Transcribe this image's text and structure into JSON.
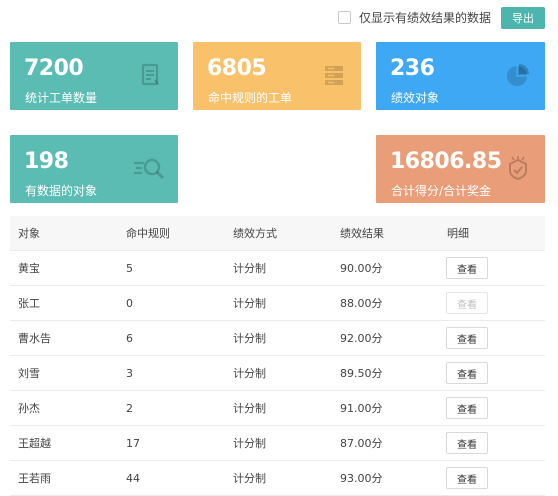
{
  "toolbar": {
    "filter_label": "仅显示有绩效结果的数据",
    "export_label": "导出"
  },
  "cards": [
    {
      "value": "7200",
      "label": "统计工单数量",
      "icon": "document-icon",
      "color": "#5bbcb4"
    },
    {
      "value": "6805",
      "label": "命中规则的工单",
      "icon": "layers-icon",
      "color": "#f9c169"
    },
    {
      "value": "236",
      "label": "绩效对象",
      "icon": "pie-chart-icon",
      "color": "#3fa8f4"
    },
    {
      "value": "198",
      "label": "有数据的对象",
      "icon": "search-icon",
      "color": "#5bbcb4"
    },
    {
      "value": "16806.85",
      "label": "合计得分/合计奖金",
      "icon": "reward-icon",
      "color": "#e99d78"
    }
  ],
  "table": {
    "headers": [
      "对象",
      "命中规则",
      "绩效方式",
      "绩效结果",
      "明细"
    ],
    "rows": [
      {
        "name": "黄宝",
        "rules": "5",
        "method": "计分制",
        "result": "90.00分",
        "action": "查看",
        "disabled": false
      },
      {
        "name": "张工",
        "rules": "0",
        "method": "计分制",
        "result": "88.00分",
        "action": "查看",
        "disabled": true
      },
      {
        "name": "曹水告",
        "rules": "6",
        "method": "计分制",
        "result": "92.00分",
        "action": "查看",
        "disabled": false
      },
      {
        "name": "刘雪",
        "rules": "3",
        "method": "计分制",
        "result": "89.50分",
        "action": "查看",
        "disabled": false
      },
      {
        "name": "孙杰",
        "rules": "2",
        "method": "计分制",
        "result": "91.00分",
        "action": "查看",
        "disabled": false
      },
      {
        "name": "王超越",
        "rules": "17",
        "method": "计分制",
        "result": "87.00分",
        "action": "查看",
        "disabled": false
      },
      {
        "name": "王若雨",
        "rules": "44",
        "method": "计分制",
        "result": "93.00分",
        "action": "查看",
        "disabled": false
      }
    ]
  }
}
